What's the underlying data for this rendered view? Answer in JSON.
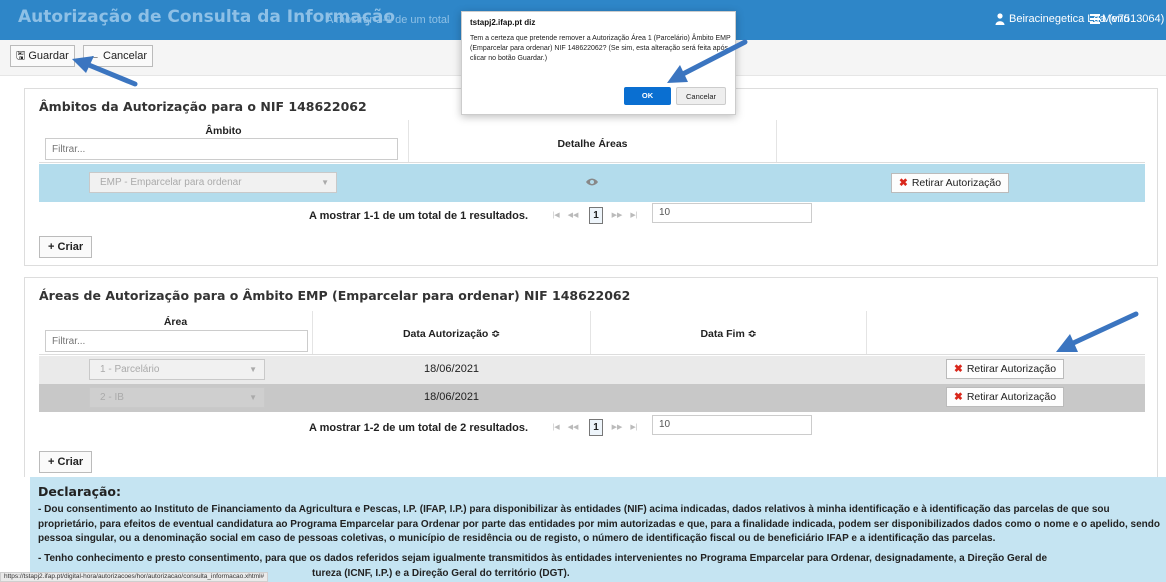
{
  "header": {
    "title": "Autorização de Consulta da Informação",
    "subtitle": "A mostrar 1-1 de um total",
    "user": "Beiracinegetica Lda (v7513064)",
    "menu": "Menu",
    "user_icon": "user-icon",
    "menu_icon": "menu-icon"
  },
  "toolbar": {
    "save_label": "Guardar",
    "cancel_label": "Cancelar"
  },
  "ambitos": {
    "title": "Âmbitos da Autorização para o NIF 148622062",
    "col_ambito": "Âmbito",
    "col_detalhe": "Detalhe Áreas",
    "filter_placeholder": "Filtrar...",
    "rows": [
      {
        "ambito": "EMP - Emparcelar para ordenar",
        "action": "Retirar Autorização"
      }
    ],
    "pager_text": "A mostrar 1-1 de um total de 1 resultados.",
    "page": "1",
    "page_size": "10",
    "create_label": "Criar"
  },
  "areas": {
    "title": "Áreas de Autorização para o Âmbito EMP (Emparcelar para ordenar) NIF 148622062",
    "col_area": "Área",
    "col_data": "Data Autorização ≎",
    "col_fim": "Data Fim ≎",
    "filter_placeholder": "Filtrar...",
    "rows": [
      {
        "area": "1 - Parcelário",
        "data": "18/06/2021",
        "fim": "",
        "action": "Retirar Autorização"
      },
      {
        "area": "2 - IB",
        "data": "18/06/2021",
        "fim": "",
        "action": "Retirar Autorização"
      }
    ],
    "pager_text": "A mostrar 1-2 de um total de 2 resultados.",
    "page": "1",
    "page_size": "10",
    "create_label": "Criar"
  },
  "declaracao": {
    "title": "Declaração:",
    "p1": "- Dou consentimento ao Instituto de Financiamento da Agricultura e Pescas, I.P. (IFAP, I.P.) para disponibilizar às entidades (NIF) acima indicadas, dados relativos à minha identificação e à identificação das parcelas de que sou proprietário, para efeitos de eventual candidatura ao Programa Emparcelar para Ordenar por parte das entidades por mim autorizadas e que, para a finalidade indicada, podem ser disponibilizados dados como o nome e o apelido, sendo pessoa singular, ou a denominação social em caso de pessoas coletivas, o município de residência ou de registo, o número de identificação fiscal ou de beneficiário IFAP e a identificação das parcelas.",
    "p2": "- Tenho conhecimento e presto consentimento, para que os dados referidos sejam igualmente transmitidos às entidades intervenientes no Programa Emparcelar para Ordenar, designadamente, a Direção Geral de",
    "p3": "tureza (ICNF, I.P.) e a Direção Geral do território (DGT)."
  },
  "status_url": "https://tstapj2.ifap.pt/digital-hora/autorizacoes/hor/autorizacao/consulta_informacao.xhtml#",
  "dialog": {
    "host": "tstapj2.ifap.pt diz",
    "message": "Tem a certeza que pretende remover a Autorização Área 1 (Parcelário) Âmbito EMP (Emparcelar para ordenar) NIF 148622062? (Se sim, esta alteração será feita após clicar no botão Guardar.)",
    "ok": "OK",
    "cancel": "Cancelar"
  },
  "colors": {
    "header_bg": "#2e86c8",
    "selected_row": "#b3dcec",
    "gray_row": "#c8c8c8",
    "declaration_bg": "#c5e4f2",
    "ok_button": "#0a6fd1",
    "arrow": "#3b75c0",
    "remove_x": "#d9271b"
  }
}
